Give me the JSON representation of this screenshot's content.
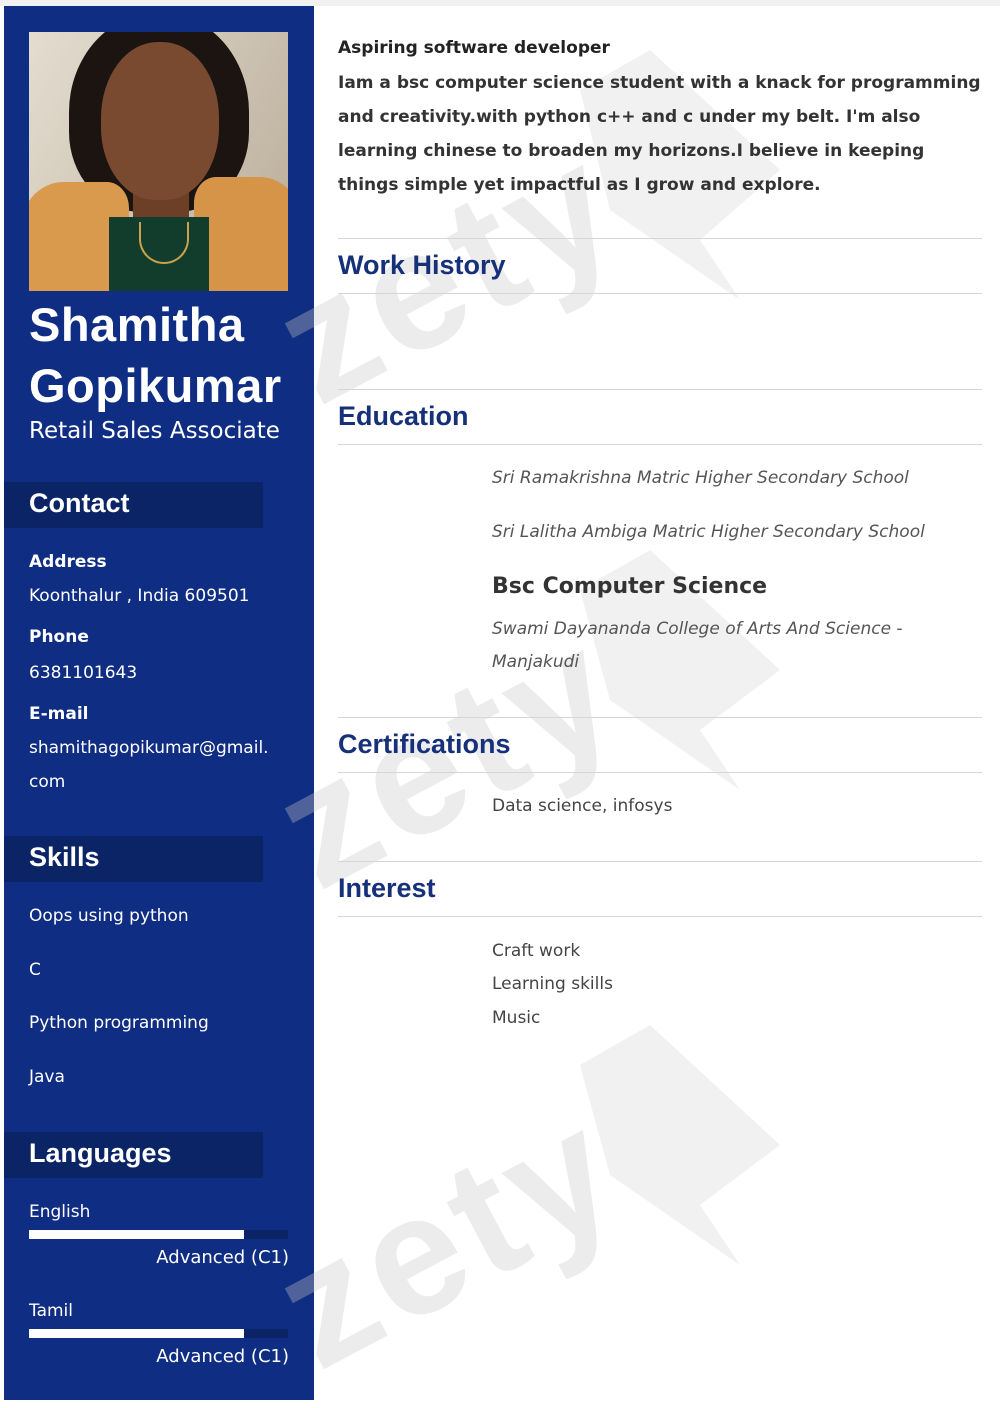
{
  "profile": {
    "first_name": "Shamitha",
    "last_name": "Gopikumar",
    "title": "Retail Sales Associate"
  },
  "contact": {
    "heading": "Contact",
    "address_label": "Address",
    "address": "Koonthalur , India 609501",
    "phone_label": "Phone",
    "phone": "6381101643",
    "email_label": "E-mail",
    "email_line1": "shamithagopikumar@gmail.",
    "email_line2": "com"
  },
  "skills": {
    "heading": "Skills",
    "items": [
      "Oops using python",
      "C",
      "Python programming",
      "Java"
    ]
  },
  "languages": {
    "heading": "Languages",
    "items": [
      {
        "name": "English",
        "level": "Advanced (C1)",
        "proficiency": 0.83
      },
      {
        "name": "Tamil",
        "level": "Advanced (C1)",
        "proficiency": 0.83
      }
    ]
  },
  "summary": {
    "title": "Aspiring software developer",
    "body": "Iam a bsc computer science student with a knack for programming and creativity.with python c++ and c under my belt. I'm also learning chinese to broaden my horizons.I believe in keeping things simple yet impactful as I grow and explore."
  },
  "work_history": {
    "heading": "Work History"
  },
  "education": {
    "heading": "Education",
    "school_1": "Sri Ramakrishna Matric Higher Secondary School",
    "school_2": "Sri Lalitha Ambiga Matric Higher Secondary School",
    "degree": "Bsc Computer Science",
    "college": "Swami Dayananda College of Arts And Science - Manjakudi"
  },
  "certifications": {
    "heading": "Certifications",
    "item": "Data science, infosys"
  },
  "interest": {
    "heading": "Interest",
    "items": [
      "Craft work",
      "Learning skills",
      "Music"
    ]
  },
  "watermark": "zety",
  "colors": {
    "sidebar": "#0f2d82",
    "band": "#0b2466",
    "heading": "#16307a"
  }
}
